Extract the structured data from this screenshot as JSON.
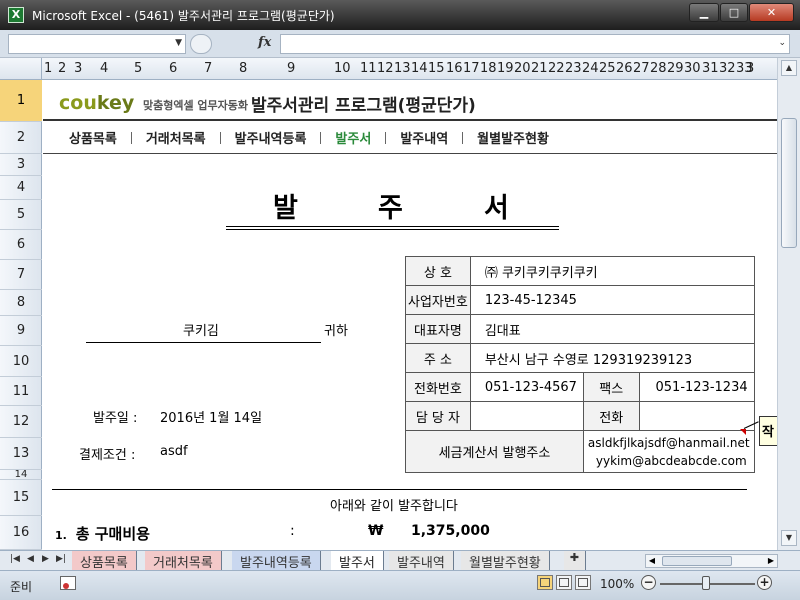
{
  "window": {
    "title": "Microsoft Excel - (5461) 발주서관리 프로그램(평균단가)",
    "app_icon": "excel-icon",
    "minimize_glyph": "▁",
    "maximize_glyph": "□",
    "close_glyph": "✕"
  },
  "formula_bar": {
    "name_box": "",
    "fx_label": "fx",
    "formula": ""
  },
  "columns": [
    "1",
    "2",
    "3",
    "4",
    "5",
    "6",
    "7",
    "8",
    "9",
    "10",
    "11",
    "12",
    "13",
    "14",
    "15",
    "16",
    "17",
    "18",
    "19",
    "20",
    "21",
    "22",
    "23",
    "24",
    "25",
    "26",
    "27",
    "28",
    "29",
    "30",
    "31",
    "32",
    "33",
    "3"
  ],
  "rows": [
    "1",
    "2",
    "3",
    "4",
    "5",
    "6",
    "7",
    "8",
    "9",
    "10",
    "11",
    "12",
    "13",
    "14",
    "15",
    "16"
  ],
  "header": {
    "brand_main": "cou",
    "brand_accent": "key",
    "brand_sub": "맞춤형엑셀 업무자동화",
    "program_title": "발주서관리 프로그램(평균단가)"
  },
  "menu": [
    {
      "label": "상품목록",
      "active": false
    },
    {
      "label": "거래처목록",
      "active": false
    },
    {
      "label": "발주내역등록",
      "active": false
    },
    {
      "label": "발주서",
      "active": true
    },
    {
      "label": "발주내역",
      "active": false
    },
    {
      "label": "월별발주현황",
      "active": false
    }
  ],
  "document": {
    "title_chars": [
      "발",
      "주",
      "서"
    ],
    "recipient": "쿠키김",
    "honorific": "귀하",
    "order_date_label": "발주일 :",
    "order_date": "2016년 1월 14일",
    "payment_terms_label": "결제조건 :",
    "payment_terms": "asdf"
  },
  "supplier": {
    "company_label": "상      호",
    "company": "㈜ 쿠키쿠키쿠키쿠키",
    "bizno_label": "사업자번호",
    "bizno": "123-45-12345",
    "ceo_label": "대표자명",
    "ceo": "김대표",
    "address_label": "주      소",
    "address": "부산시 남구 수영로 129319239123",
    "phone_label": "전화번호",
    "phone": "051-123-4567",
    "fax_label": "팩스",
    "fax": "051-123-1234",
    "manager_label": "담 당 자",
    "manager": "",
    "manager_phone_label": "전화",
    "manager_phone": "",
    "tax_email_label": "세금계산서 발행주소",
    "tax_email_1": "asldkfjlkajsdf@hanmail.net",
    "tax_email_2": "yykim@abcdeabcde.com"
  },
  "comment_note": "작",
  "intro_text": "아래와 같이 발주합니다",
  "summary": {
    "number": "1.",
    "label": "총 구매비용",
    "colon": ":",
    "currency": "₩",
    "amount": "1,375,000"
  },
  "sheet_tabs": [
    {
      "label": "상품목록"
    },
    {
      "label": "거래처목록"
    },
    {
      "label": "발주내역등록"
    },
    {
      "label": "발주서"
    },
    {
      "label": "발주내역"
    },
    {
      "label": "월별발주현황"
    }
  ],
  "status": {
    "ready": "준비",
    "zoom": "100%",
    "zoom_minus": "−",
    "zoom_plus": "+"
  }
}
